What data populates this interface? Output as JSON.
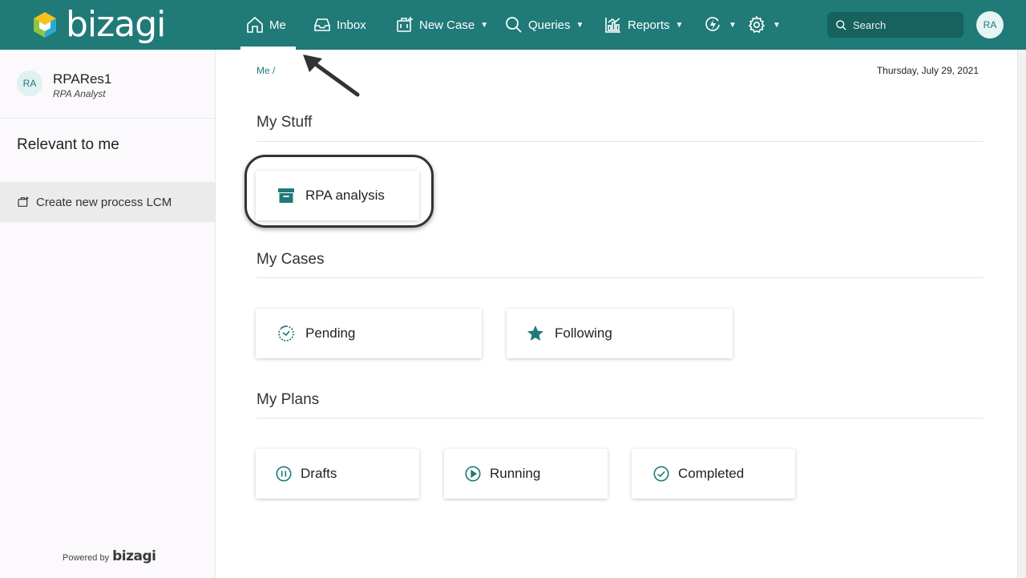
{
  "brand": {
    "logo_text": "bizagi",
    "accent": "#1f7a78"
  },
  "nav": {
    "me": "Me",
    "inbox": "Inbox",
    "new_case": "New Case",
    "queries": "Queries",
    "reports": "Reports",
    "search_placeholder": "Search",
    "avatar": "RA"
  },
  "sidebar": {
    "avatar": "RA",
    "user_name": "RPARes1",
    "user_role": "RPA Analyst",
    "relevant": "Relevant to me",
    "create_item": "Create new process LCM",
    "powered_by": "Powered by",
    "powered_logo": "bizagi"
  },
  "main": {
    "breadcrumb": "Me /",
    "date": "Thursday, July 29, 2021",
    "my_stuff": {
      "title": "My Stuff",
      "rpa_analysis": "RPA analysis"
    },
    "my_cases": {
      "title": "My Cases",
      "pending": "Pending",
      "following": "Following"
    },
    "my_plans": {
      "title": "My Plans",
      "drafts": "Drafts",
      "running": "Running",
      "completed": "Completed"
    }
  }
}
